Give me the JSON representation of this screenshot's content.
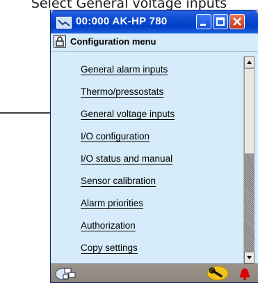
{
  "caption": "Select General voltage inputs",
  "window": {
    "title": "00:000 AK-HP 780",
    "buttons": {
      "minimize": "minimize",
      "maximize": "maximize",
      "close": "close"
    }
  },
  "menubar": {
    "title": "Configuration menu",
    "icon": "lock-icon"
  },
  "menu_items": [
    "General alarm inputs",
    "Thermo/pressostats",
    "General voltage inputs",
    "I/O configuration",
    "I/O status and manual",
    "Sensor calibration",
    "Alarm priorities",
    "Authorization",
    "Copy settings"
  ],
  "pointed_item": "General voltage inputs",
  "statusbar": {
    "left_icon": "network-icon",
    "right_icons": [
      "wrench-icon",
      "alarm-bell-icon"
    ]
  },
  "colors": {
    "title_bar": "#0a49cf",
    "content_bg": "#d6ecfa",
    "close_button": "#c3391c",
    "status_bar": "#938d83",
    "alarm": "#e00000",
    "wrench_badge": "#f3c31b"
  }
}
